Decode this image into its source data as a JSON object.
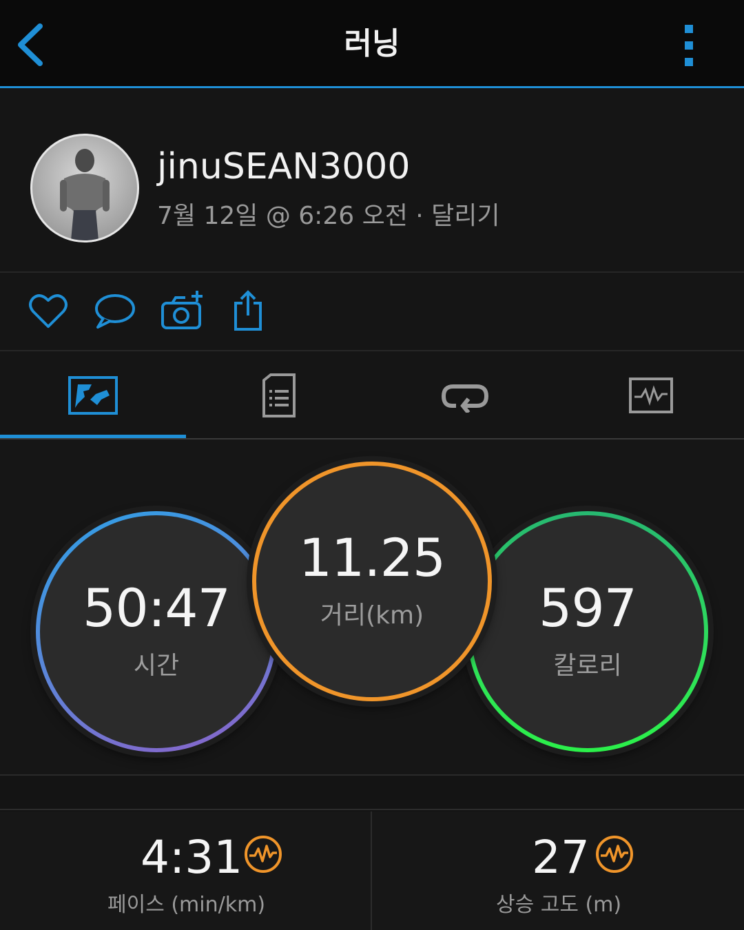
{
  "header": {
    "title": "러닝"
  },
  "profile": {
    "username": "jinuSEAN3000",
    "meta": "7월 12일 @ 6:26 오전 · 달리기"
  },
  "actions": [
    "like-icon",
    "comment-icon",
    "add-photo-icon",
    "share-icon"
  ],
  "tabs": [
    "overview-icon",
    "stats-icon",
    "laps-icon",
    "charts-icon"
  ],
  "summary": {
    "time": {
      "value": "50:47",
      "label": "시간"
    },
    "distance": {
      "value": "11.25",
      "label": "거리(km)"
    },
    "calories": {
      "value": "597",
      "label": "칼로리"
    }
  },
  "stats": [
    {
      "value": "4:31",
      "label": "페이스 (min/km)"
    },
    {
      "value": "27",
      "label": "상승 고도 (m)"
    }
  ],
  "colors": {
    "accent": "#1f8fd6",
    "distance_ring": "#f0952a",
    "time_ring_start": "#2ea0e6",
    "time_ring_end": "#8c62c9",
    "calorie_ring": "#2fe05a",
    "pulse_icon": "#f0952a"
  }
}
